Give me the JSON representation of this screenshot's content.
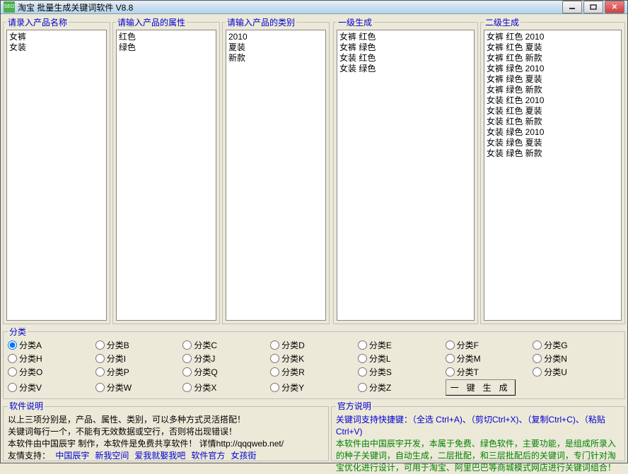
{
  "window": {
    "title": "淘宝 批量生成关键词软件 V8.8",
    "icon_label": "SEO"
  },
  "panels": {
    "names": {
      "legend": "请录入产品名称",
      "items": [
        "女裤",
        "女装"
      ]
    },
    "attrs": {
      "legend": "请输入产品的属性",
      "items": [
        "红色",
        "绿色"
      ]
    },
    "cats": {
      "legend": "请输入产品的类别",
      "items": [
        "2010",
        "夏装",
        "新款"
      ]
    },
    "gen1": {
      "legend": "一级生成",
      "items": [
        "女裤 红色",
        "女裤 绿色",
        "女装 红色",
        "女装 绿色"
      ]
    },
    "gen2": {
      "legend": "二级生成",
      "items": [
        "女裤 红色 2010",
        "女裤 红色 夏装",
        "女裤 红色 新款",
        "女裤 绿色 2010",
        "女裤 绿色 夏装",
        "女裤 绿色 新款",
        "女装 红色 2010",
        "女装 红色 夏装",
        "女装 红色 新款",
        "女装 绿色 2010",
        "女装 绿色 夏装",
        "女装 绿色 新款"
      ]
    }
  },
  "categories": {
    "legend": "分类",
    "items": [
      "分类A",
      "分类B",
      "分类C",
      "分类D",
      "分类E",
      "分类F",
      "分类G",
      "分类H",
      "分类I",
      "分类J",
      "分类K",
      "分类L",
      "分类M",
      "分类N",
      "分类O",
      "分类P",
      "分类Q",
      "分类R",
      "分类S",
      "分类T",
      "分类U",
      "分类V",
      "分类W",
      "分类X",
      "分类Y",
      "分类Z"
    ],
    "selected": 0,
    "generate_label": "一 键 生 成"
  },
  "software_desc": {
    "legend": "软件说明",
    "line1": "以上三项分别是，产品、属性、类别，可以多种方式灵活搭配！",
    "line2": "关键词每行一个，不能有无效数据或空行，否则将出现错误！",
    "line3": "本软件由中国辰宇 制作，本软件是免费共享软件！ 详情http://qqqweb.net/",
    "links_label": "友情支持：",
    "links": [
      "中国辰宇",
      "新我空间",
      "爱我就娶我吧",
      "软件官方",
      "女孩街"
    ]
  },
  "official_desc": {
    "legend": "官方说明",
    "line1": "关键词支持快捷键：（全选 Ctrl+A)、（剪切Ctrl+X)、（复制Ctrl+C)、（粘贴Ctrl+V)",
    "line2": "本软件由中国辰宇开发，本属于免费、绿色软件，主要功能，是组成所录入的种子关键词，自动生成，二层批配，和三层批配后的关键词，专门针对淘宝优化进行设计，可用于淘宝、阿里巴巴等商城模式网店进行关键词组合！"
  }
}
